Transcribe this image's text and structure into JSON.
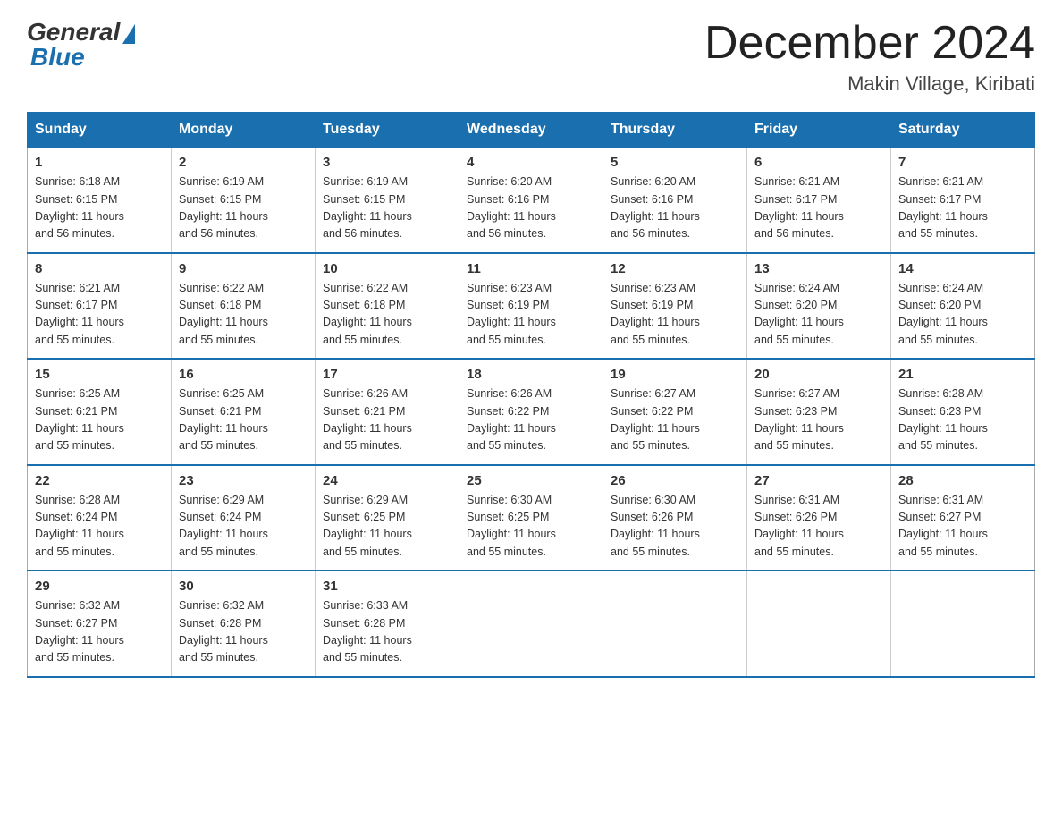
{
  "header": {
    "logo": {
      "general": "General",
      "blue": "Blue"
    },
    "title": "December 2024",
    "location": "Makin Village, Kiribati"
  },
  "days_of_week": [
    "Sunday",
    "Monday",
    "Tuesday",
    "Wednesday",
    "Thursday",
    "Friday",
    "Saturday"
  ],
  "weeks": [
    [
      {
        "day": "1",
        "sunrise": "6:18 AM",
        "sunset": "6:15 PM",
        "daylight": "11 hours and 56 minutes."
      },
      {
        "day": "2",
        "sunrise": "6:19 AM",
        "sunset": "6:15 PM",
        "daylight": "11 hours and 56 minutes."
      },
      {
        "day": "3",
        "sunrise": "6:19 AM",
        "sunset": "6:15 PM",
        "daylight": "11 hours and 56 minutes."
      },
      {
        "day": "4",
        "sunrise": "6:20 AM",
        "sunset": "6:16 PM",
        "daylight": "11 hours and 56 minutes."
      },
      {
        "day": "5",
        "sunrise": "6:20 AM",
        "sunset": "6:16 PM",
        "daylight": "11 hours and 56 minutes."
      },
      {
        "day": "6",
        "sunrise": "6:21 AM",
        "sunset": "6:17 PM",
        "daylight": "11 hours and 56 minutes."
      },
      {
        "day": "7",
        "sunrise": "6:21 AM",
        "sunset": "6:17 PM",
        "daylight": "11 hours and 55 minutes."
      }
    ],
    [
      {
        "day": "8",
        "sunrise": "6:21 AM",
        "sunset": "6:17 PM",
        "daylight": "11 hours and 55 minutes."
      },
      {
        "day": "9",
        "sunrise": "6:22 AM",
        "sunset": "6:18 PM",
        "daylight": "11 hours and 55 minutes."
      },
      {
        "day": "10",
        "sunrise": "6:22 AM",
        "sunset": "6:18 PM",
        "daylight": "11 hours and 55 minutes."
      },
      {
        "day": "11",
        "sunrise": "6:23 AM",
        "sunset": "6:19 PM",
        "daylight": "11 hours and 55 minutes."
      },
      {
        "day": "12",
        "sunrise": "6:23 AM",
        "sunset": "6:19 PM",
        "daylight": "11 hours and 55 minutes."
      },
      {
        "day": "13",
        "sunrise": "6:24 AM",
        "sunset": "6:20 PM",
        "daylight": "11 hours and 55 minutes."
      },
      {
        "day": "14",
        "sunrise": "6:24 AM",
        "sunset": "6:20 PM",
        "daylight": "11 hours and 55 minutes."
      }
    ],
    [
      {
        "day": "15",
        "sunrise": "6:25 AM",
        "sunset": "6:21 PM",
        "daylight": "11 hours and 55 minutes."
      },
      {
        "day": "16",
        "sunrise": "6:25 AM",
        "sunset": "6:21 PM",
        "daylight": "11 hours and 55 minutes."
      },
      {
        "day": "17",
        "sunrise": "6:26 AM",
        "sunset": "6:21 PM",
        "daylight": "11 hours and 55 minutes."
      },
      {
        "day": "18",
        "sunrise": "6:26 AM",
        "sunset": "6:22 PM",
        "daylight": "11 hours and 55 minutes."
      },
      {
        "day": "19",
        "sunrise": "6:27 AM",
        "sunset": "6:22 PM",
        "daylight": "11 hours and 55 minutes."
      },
      {
        "day": "20",
        "sunrise": "6:27 AM",
        "sunset": "6:23 PM",
        "daylight": "11 hours and 55 minutes."
      },
      {
        "day": "21",
        "sunrise": "6:28 AM",
        "sunset": "6:23 PM",
        "daylight": "11 hours and 55 minutes."
      }
    ],
    [
      {
        "day": "22",
        "sunrise": "6:28 AM",
        "sunset": "6:24 PM",
        "daylight": "11 hours and 55 minutes."
      },
      {
        "day": "23",
        "sunrise": "6:29 AM",
        "sunset": "6:24 PM",
        "daylight": "11 hours and 55 minutes."
      },
      {
        "day": "24",
        "sunrise": "6:29 AM",
        "sunset": "6:25 PM",
        "daylight": "11 hours and 55 minutes."
      },
      {
        "day": "25",
        "sunrise": "6:30 AM",
        "sunset": "6:25 PM",
        "daylight": "11 hours and 55 minutes."
      },
      {
        "day": "26",
        "sunrise": "6:30 AM",
        "sunset": "6:26 PM",
        "daylight": "11 hours and 55 minutes."
      },
      {
        "day": "27",
        "sunrise": "6:31 AM",
        "sunset": "6:26 PM",
        "daylight": "11 hours and 55 minutes."
      },
      {
        "day": "28",
        "sunrise": "6:31 AM",
        "sunset": "6:27 PM",
        "daylight": "11 hours and 55 minutes."
      }
    ],
    [
      {
        "day": "29",
        "sunrise": "6:32 AM",
        "sunset": "6:27 PM",
        "daylight": "11 hours and 55 minutes."
      },
      {
        "day": "30",
        "sunrise": "6:32 AM",
        "sunset": "6:28 PM",
        "daylight": "11 hours and 55 minutes."
      },
      {
        "day": "31",
        "sunrise": "6:33 AM",
        "sunset": "6:28 PM",
        "daylight": "11 hours and 55 minutes."
      },
      null,
      null,
      null,
      null
    ]
  ],
  "labels": {
    "sunrise": "Sunrise:",
    "sunset": "Sunset:",
    "daylight": "Daylight:"
  }
}
